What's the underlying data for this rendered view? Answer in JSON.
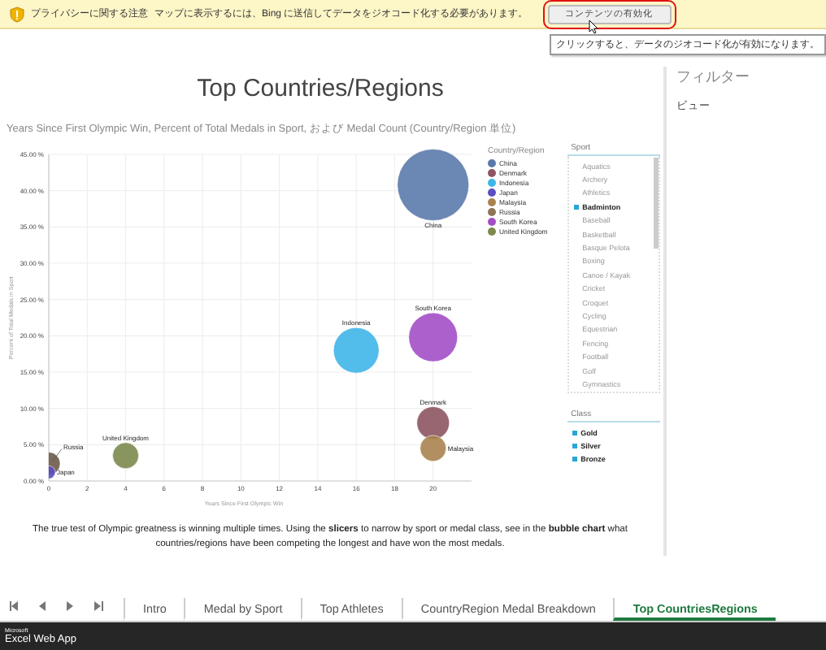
{
  "notification_bar": {
    "label": "プライバシーに関する注意",
    "message": "マップに表示するには、Bing に送信してデータをジオコード化する必要があります。",
    "button": "コンテンツの有効化",
    "tooltip": "クリックすると、データのジオコード化が有効になります。"
  },
  "sheet": {
    "title": "Top Countries/Regions",
    "chart_data": {
      "type": "scatter",
      "title": "Years Since First Olympic Win, Percent of Total Medals in Sport, および Medal Count (Country/Region 単位)",
      "xlabel": "Years Since First Olympic Win",
      "ylabel": "Percent of Total Medals in Sport",
      "xlim": [
        0,
        22
      ],
      "ylim": [
        0,
        45
      ],
      "xticks": [
        0,
        2,
        4,
        6,
        8,
        10,
        12,
        14,
        16,
        18,
        20
      ],
      "yticks": [
        {
          "value": 0,
          "label": "0.00 %"
        },
        {
          "value": 5,
          "label": "5.00 %"
        },
        {
          "value": 10,
          "label": "10.00 %"
        },
        {
          "value": 15,
          "label": "15.00 %"
        },
        {
          "value": 20,
          "label": "20.00 %"
        },
        {
          "value": 25,
          "label": "25.00 %"
        },
        {
          "value": 30,
          "label": "30.00 %"
        },
        {
          "value": 35,
          "label": "35.00 %"
        },
        {
          "value": 40,
          "label": "40.00 %"
        },
        {
          "value": 45,
          "label": "45.00 %"
        }
      ],
      "grid": true,
      "series": [
        {
          "name": "China",
          "color": "#5b7aab",
          "x": [
            20
          ],
          "values": [
            40.8
          ]
        },
        {
          "name": "Indonesia",
          "color": "#3fb5e8",
          "x": [
            16
          ],
          "values": [
            18
          ]
        },
        {
          "name": "South Korea",
          "color": "#a24fc6",
          "x": [
            20
          ],
          "values": [
            19.8
          ]
        },
        {
          "name": "Denmark",
          "color": "#8d5561",
          "x": [
            20
          ],
          "values": [
            8
          ]
        },
        {
          "name": "Malaysia",
          "color": "#a9834f",
          "x": [
            20
          ],
          "values": [
            4.5
          ]
        },
        {
          "name": "United Kingdom",
          "color": "#7c8a4e",
          "x": [
            4
          ],
          "values": [
            3.5
          ]
        },
        {
          "name": "Russia",
          "color": "#6e5a48",
          "x": [
            0
          ],
          "values": [
            2.4
          ]
        },
        {
          "name": "Japan",
          "color": "#5a4ec2",
          "x": [
            0
          ],
          "values": [
            1.2
          ]
        }
      ]
    },
    "legend": {
      "title": "Country/Region",
      "items": [
        {
          "label": "China",
          "color": "#5b7aab"
        },
        {
          "label": "Denmark",
          "color": "#8d5561"
        },
        {
          "label": "Indonesia",
          "color": "#3fb5e8"
        },
        {
          "label": "Japan",
          "color": "#5a4ec2"
        },
        {
          "label": "Malaysia",
          "color": "#a9834f"
        },
        {
          "label": "Russia",
          "color": "#8b7553"
        },
        {
          "label": "South Korea",
          "color": "#a24fc6"
        },
        {
          "label": "United Kingdom",
          "color": "#7c8a4e"
        }
      ]
    },
    "slicers": [
      {
        "title": "Sport",
        "scrollable": true,
        "items": [
          {
            "label": "Aquatics",
            "selected": false
          },
          {
            "label": "Archery",
            "selected": false
          },
          {
            "label": "Athletics",
            "selected": false
          },
          {
            "label": "Badminton",
            "selected": true
          },
          {
            "label": "Baseball",
            "selected": false
          },
          {
            "label": "Basketball",
            "selected": false
          },
          {
            "label": "Basque Pelota",
            "selected": false
          },
          {
            "label": "Boxing",
            "selected": false
          },
          {
            "label": "Canoe / Kayak",
            "selected": false
          },
          {
            "label": "Cricket",
            "selected": false
          },
          {
            "label": "Croquet",
            "selected": false
          },
          {
            "label": "Cycling",
            "selected": false
          },
          {
            "label": "Equestrian",
            "selected": false
          },
          {
            "label": "Fencing",
            "selected": false
          },
          {
            "label": "Football",
            "selected": false
          },
          {
            "label": "Golf",
            "selected": false
          },
          {
            "label": "Gymnastics",
            "selected": false
          }
        ]
      },
      {
        "title": "Class",
        "scrollable": false,
        "items": [
          {
            "label": "Gold",
            "selected": true
          },
          {
            "label": "Silver",
            "selected": true
          },
          {
            "label": "Bronze",
            "selected": true
          }
        ]
      }
    ],
    "description": "The true test of Olympic greatness is winning multiple times. Using the **slicers** to narrow by sport or medal class, see in the **bubble chart** what countries/regions have been competing the longest and have won the most medals."
  },
  "filter_pane": {
    "title": "フィルター",
    "item": "ビュー"
  },
  "sheet_tabs": [
    {
      "label": "Intro",
      "selected": false
    },
    {
      "label": "Medal by Sport",
      "selected": false
    },
    {
      "label": "Top Athletes",
      "selected": false
    },
    {
      "label": "CountryRegion Medal Breakdown",
      "selected": false
    },
    {
      "label": "Top CountriesRegions",
      "selected": true
    }
  ],
  "app_bar": {
    "brand": "Microsoft",
    "product": "Excel Web App"
  }
}
